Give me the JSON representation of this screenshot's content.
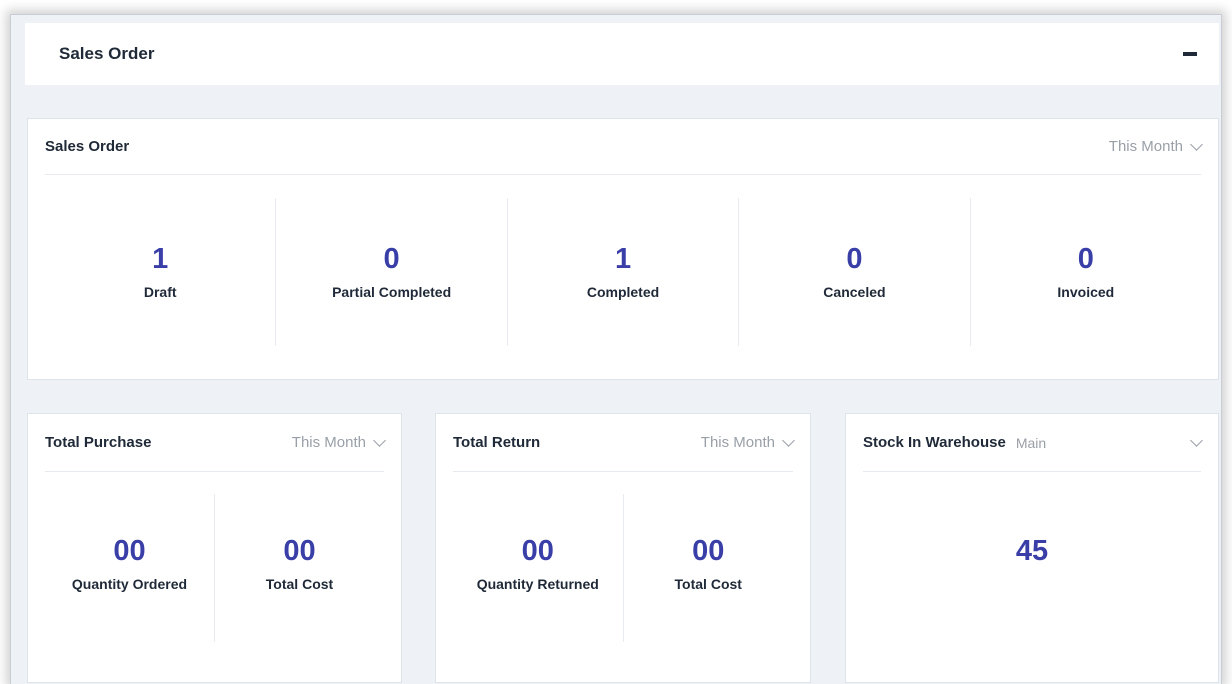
{
  "header": {
    "title": "Sales Order"
  },
  "sales_order_card": {
    "title": "Sales Order",
    "period": "This Month",
    "stats": [
      {
        "value": "1",
        "label": "Draft"
      },
      {
        "value": "0",
        "label": "Partial Completed"
      },
      {
        "value": "1",
        "label": "Completed"
      },
      {
        "value": "0",
        "label": "Canceled"
      },
      {
        "value": "0",
        "label": "Invoiced"
      }
    ]
  },
  "total_purchase_card": {
    "title": "Total Purchase",
    "period": "This Month",
    "stats": [
      {
        "value": "00",
        "label": "Quantity Ordered"
      },
      {
        "value": "00",
        "label": "Total Cost"
      }
    ]
  },
  "total_return_card": {
    "title": "Total Return",
    "period": "This Month",
    "stats": [
      {
        "value": "00",
        "label": "Quantity Returned"
      },
      {
        "value": "00",
        "label": "Total Cost"
      }
    ]
  },
  "stock_card": {
    "title": "Stock In Warehouse",
    "warehouse": "Main",
    "value": "45"
  },
  "colors": {
    "accent": "#3a3fa8",
    "background": "#eef1f6",
    "muted_text": "#9aa0a8"
  }
}
